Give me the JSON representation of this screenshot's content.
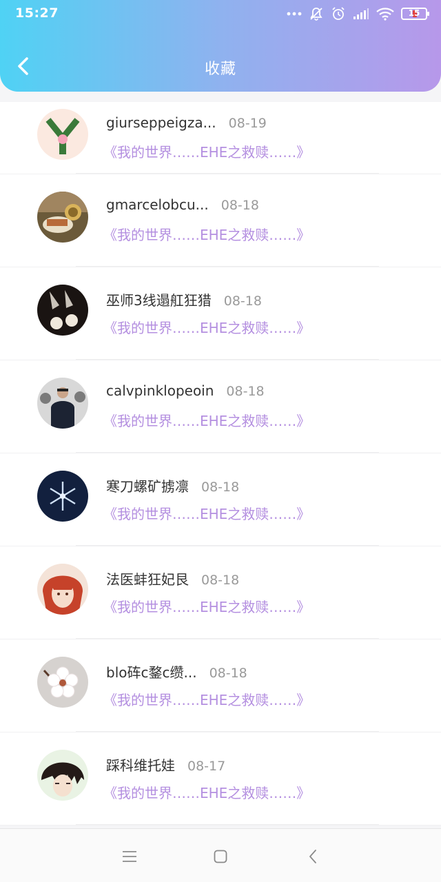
{
  "status_bar": {
    "time": "15:27",
    "battery": "15",
    "icons": [
      "more-dots-icon",
      "notifications-off-icon",
      "alarm-icon",
      "signal-icon",
      "wifi-icon",
      "battery-icon"
    ]
  },
  "header": {
    "title": "收藏",
    "back_icon": "back-arrow-icon",
    "gradient": [
      "#4fd2f4",
      "#b798ea"
    ]
  },
  "favorites": [
    {
      "name": "giurseppeigza...",
      "date": "08-19",
      "title": "《我的世界……EHE之救赎……》",
      "avatar": "avatar-letter-y"
    },
    {
      "name": "gmarcelobcu...",
      "date": "08-18",
      "title": "《我的世界……EHE之救赎……》",
      "avatar": "avatar-food"
    },
    {
      "name": "巫师3线遢舡狂猎",
      "date": "08-18",
      "title": "《我的世界……EHE之救赎……》",
      "avatar": "avatar-earrings"
    },
    {
      "name": "calvpinklopeoin",
      "date": "08-18",
      "title": "《我的世界……EHE之救赎……》",
      "avatar": "avatar-person"
    },
    {
      "name": "寒刀螺矿掳凛",
      "date": "08-18",
      "title": "《我的世界……EHE之救赎……》",
      "avatar": "avatar-snowflake"
    },
    {
      "name": "法医蚌狂妃艮",
      "date": "08-18",
      "title": "《我的世界……EHE之救赎……》",
      "avatar": "avatar-anime-red"
    },
    {
      "name": "blo砗c鍪c缵...",
      "date": "08-18",
      "title": "《我的世界……EHE之救赎……》",
      "avatar": "avatar-blossom"
    },
    {
      "name": "踩科维托娃",
      "date": "08-17",
      "title": "《我的世界……EHE之救赎……》",
      "avatar": "avatar-anime-dark"
    }
  ],
  "nav_bar": {
    "icons": [
      "menu-icon",
      "home-square-icon",
      "back-chevron-icon"
    ]
  },
  "colors": {
    "accent_purple": "#b48fe0",
    "date_gray": "#9a9a9a"
  }
}
